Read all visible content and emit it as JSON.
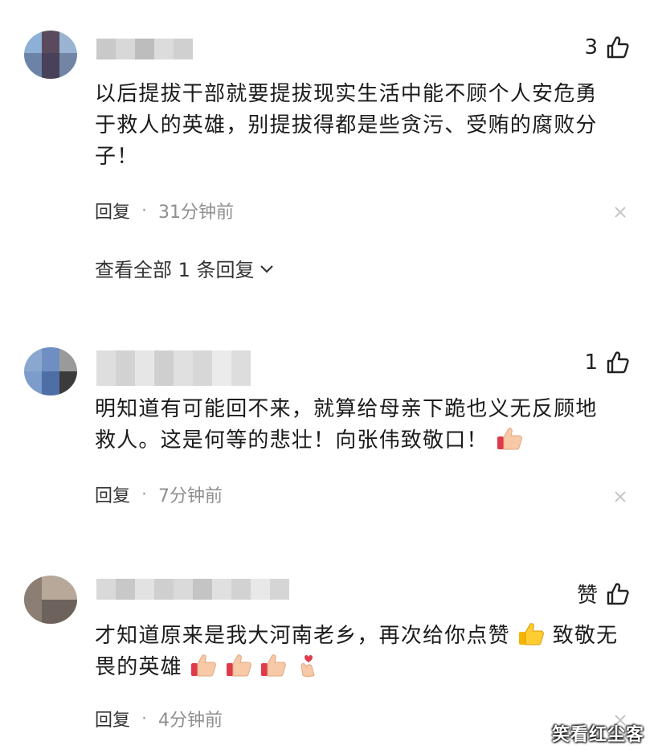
{
  "comments": [
    {
      "like_count": "3",
      "text_lines": [
        "以后提拔干部就要提拔现实生活中能不顾个人安危勇",
        "于救人的英雄，别提拔得都是些贪污、受贿的腐败分",
        "子！"
      ],
      "reply_label": "回复",
      "time": "31分钟前",
      "view_replies": "查看全部 1 条回复"
    },
    {
      "like_count": "1",
      "text_lines": [
        "明知道有可能回不来，就算给母亲下跪也义无反顾地",
        "救人。这是何等的悲壮！向张伟致敬口！"
      ],
      "reply_label": "回复",
      "time": "7分钟前"
    },
    {
      "like_count": "赞",
      "text_lines": [
        "才知道原来是我大河南老乡，再次给你点赞",
        "致敬无",
        "畏的英雄"
      ],
      "reply_label": "回复",
      "time": "4分钟前"
    }
  ],
  "separator": "·",
  "watermark": "笑看红尘客",
  "icons": {
    "like": "thumbs-up-outline-icon",
    "close": "close-icon",
    "expand": "chevron-down-icon",
    "emoji_thumb": "thumbs-up-emoji-icon",
    "emoji_heart_hand": "finger-heart-emoji-icon"
  },
  "colors": {
    "text": "#1b1b1b",
    "meta": "#8f8f8f",
    "close": "#c0c0c0"
  }
}
